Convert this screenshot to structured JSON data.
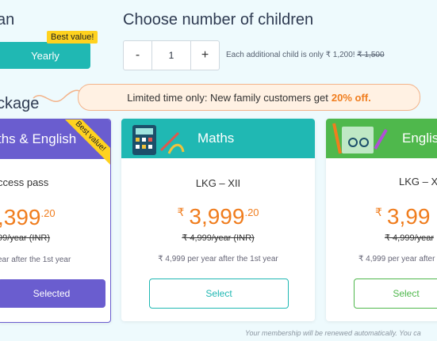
{
  "plan": {
    "title": "an",
    "yearly_label": "Yearly",
    "best_value": "Best value!"
  },
  "children": {
    "title": "Choose number of children",
    "minus": "-",
    "plus": "+",
    "count": "1",
    "note_prefix": "Each additional child is only ₹ 1,200!",
    "note_old": "₹ 1,500"
  },
  "package": {
    "title": "ckage",
    "offer_text": "Limited time only: New family customers get",
    "offer_pct": "20% off."
  },
  "cards": [
    {
      "title": "ths & English",
      "grade": "ccess pass",
      "rupee": "",
      "price_int": ",399",
      "price_dec": ".20",
      "old_price": "99/year (INR)",
      "renew": "ear after the 1st year",
      "button": "Selected",
      "ribbon": "Best value!",
      "color": "#6a5dcf"
    },
    {
      "title": "Maths",
      "grade": "LKG – XII",
      "rupee": "₹",
      "price_int": "3,999",
      "price_dec": ".20",
      "old_price": "₹ 4,999/year (INR)",
      "renew": "₹ 4,999 per year after the 1st year",
      "button": "Select",
      "color": "#20b8b3"
    },
    {
      "title": "Englis",
      "grade": "LKG – X",
      "rupee": "₹",
      "price_int": "3,99",
      "price_dec": "",
      "old_price": "₹ 4,999/year",
      "renew": "₹ 4,999 per year after the 1st",
      "button": "Select",
      "color": "#4fb84c"
    }
  ],
  "footer": {
    "renewal_note": "Your membership will be renewed automatically. You ca"
  }
}
